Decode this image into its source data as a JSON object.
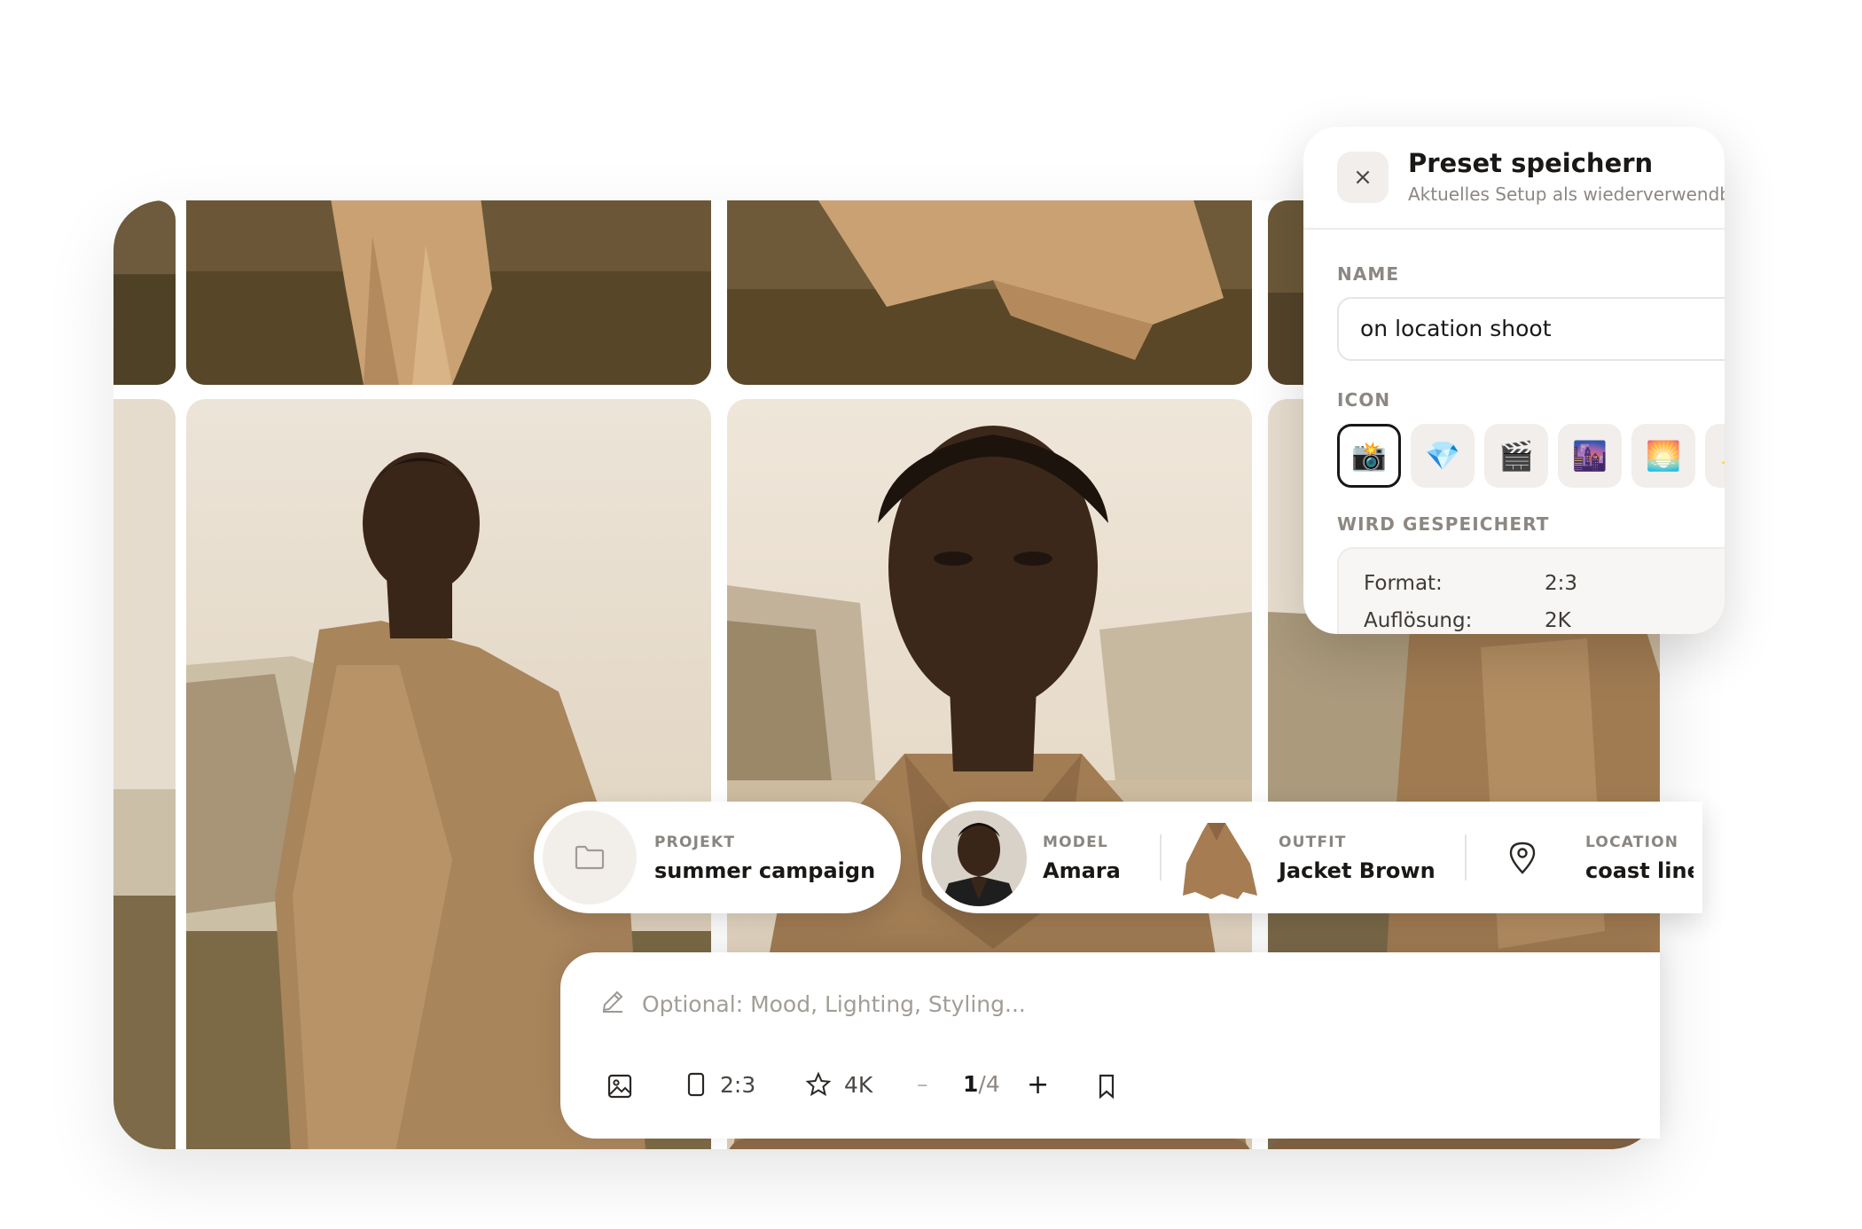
{
  "chips": {
    "project": {
      "label": "PROJEKT",
      "value": "summer campaign",
      "icon": "folder-icon"
    },
    "model": {
      "label": "MODEL",
      "value": "Amara"
    },
    "outfit": {
      "label": "OUTFIT",
      "value": "Jacket Brown"
    },
    "location": {
      "label": "LOCATION",
      "value": "coast line",
      "icon": "map-pin-icon"
    }
  },
  "prompt": {
    "placeholder": "Optional: Mood, Lighting, Styling...",
    "toolbar": {
      "image_icon": "image-icon",
      "format": "2:3",
      "resolution": "4K",
      "minus": "–",
      "count_current": "1",
      "count_total": "/4",
      "plus": "+",
      "bookmark_icon": "bookmark-icon"
    }
  },
  "preset_panel": {
    "close": "×",
    "title": "Preset speichern",
    "subtitle": "Aktuelles Setup als wiederverwendbares Preset",
    "name_label": "NAME",
    "name_value": "on location shoot",
    "icon_label": "ICON",
    "icons": [
      "📸",
      "💎",
      "🎬",
      "🌆",
      "🌅",
      "✨"
    ],
    "selected_icon_index": 0,
    "saved_label": "WIRD GESPEICHERT",
    "saved": [
      {
        "key": "Format:",
        "value": "2:3"
      },
      {
        "key": "Auflösung:",
        "value": "2K"
      }
    ]
  },
  "colors": {
    "accent": "#1a1816",
    "muted": "#8c8781",
    "panel_bg": "#ffffff",
    "chip_icon_bg": "#f2efeb",
    "photo_tone": "#c49c6e"
  }
}
